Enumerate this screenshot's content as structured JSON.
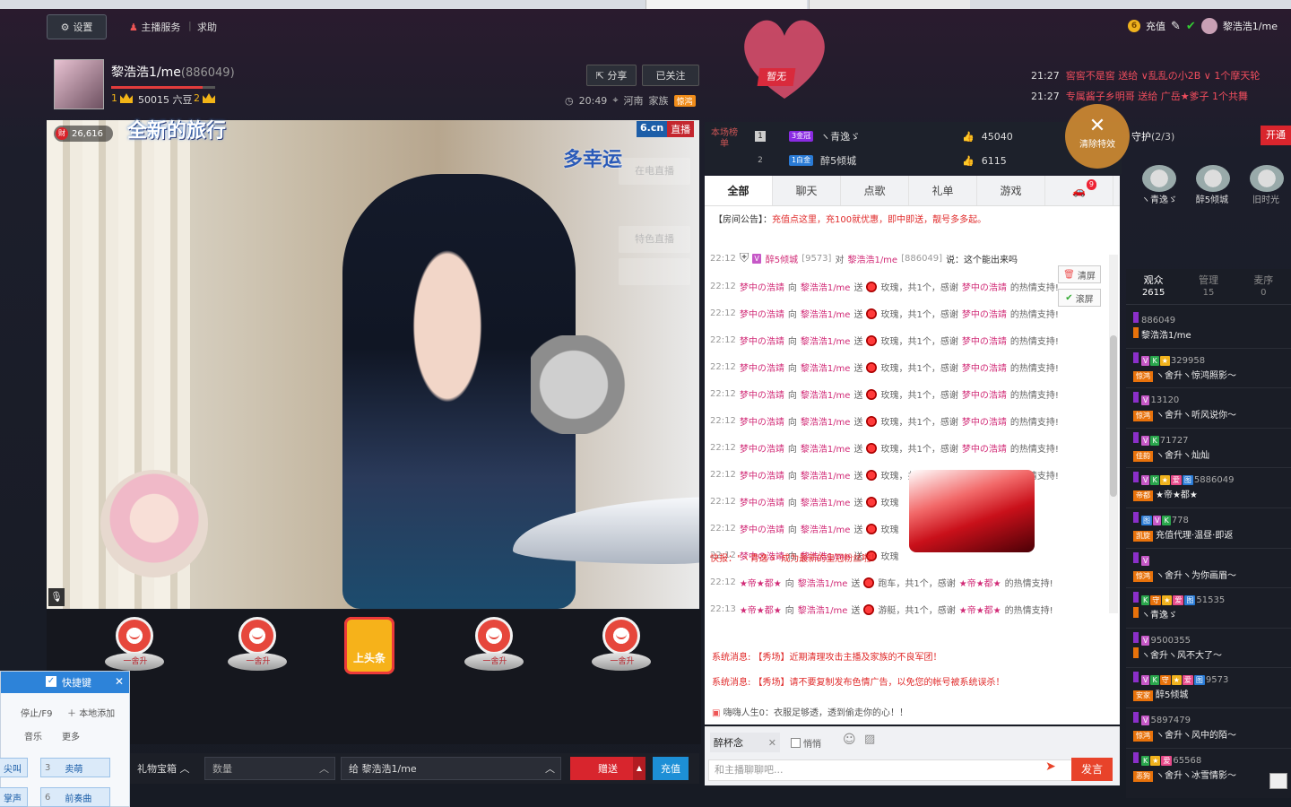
{
  "browser": {
    "tab1": "",
    "tab2": ""
  },
  "topbar": {
    "settings_label": "设置",
    "anchor_service": "主播服务",
    "help": "求助",
    "recharge": "充值",
    "username": "黎浩浩1/me"
  },
  "anchor": {
    "name": "黎浩浩1/me",
    "id": "(886049)",
    "level1": "1",
    "beans": "50015 六豆",
    "level2": "2",
    "share": "分享",
    "followed": "已关注",
    "time": "20:49",
    "location": "河南",
    "family_label": "家族",
    "family_tag": "惊鸿"
  },
  "status_tag": "暂无",
  "notifications": [
    {
      "time": "21:27",
      "text": "窖窖不是窖 送给 ∨乱乱の小2B ∨ 1个摩天轮"
    },
    {
      "time": "21:27",
      "text": "专属酱子乡明哥 送给 广岳★爹子 1个共舞"
    }
  ],
  "video": {
    "fire_count": "26,616",
    "title": "全新的旅行",
    "title2": "多幸运",
    "logo": "6.cn",
    "live": "直播",
    "side_buttons": [
      "在电直播",
      "特色直播",
      ""
    ],
    "mic_icon": "mic"
  },
  "gifts": [
    {
      "label": "一舍升"
    },
    {
      "label": "一舍升"
    },
    {
      "label": "上头条"
    },
    {
      "label": "一舍升"
    },
    {
      "label": "一舍升"
    }
  ],
  "bottombar": {
    "gift_box": "礼物宝箱",
    "quantity_placeholder": "数量",
    "to_target": "给 黎浩浩1/me",
    "send": "赠送",
    "recharge": "充值"
  },
  "quick": {
    "title": "快捷键",
    "stop": "停止/F9",
    "add_local": "本地添加",
    "tab_music": "音乐",
    "tab_more": "更多",
    "btn1_key": "",
    "btn1": "尖叫",
    "btn2_key": "3",
    "btn2": "卖萌",
    "btn3_key": "",
    "btn3": "掌声",
    "btn4_key": "6",
    "btn4": "前奏曲"
  },
  "rank": {
    "label": "本场榜单",
    "rows": [
      {
        "num": "1",
        "lv": "3金冠",
        "name": "ヽ青逸ゞ",
        "value": "45040"
      },
      {
        "num": "2",
        "lv": "1白金",
        "name": "醉5倾城",
        "value": "6115"
      }
    ]
  },
  "chat": {
    "tabs": [
      "全部",
      "聊天",
      "点歌",
      "礼单",
      "游戏",
      ""
    ],
    "car_count": "9",
    "notice_prefix": "【房间公告】：",
    "notice": "充值点这里，充100就优惠，即中即送，靓号多多起。",
    "first": {
      "time": "22:12",
      "user": "醉5倾城",
      "uid": "[9573]",
      "to": "黎浩浩1/me",
      "toid": "[886049]",
      "msg": "说：这个能出来吗"
    },
    "gift_lines": [
      {
        "time": "22:12",
        "from": "梦中の浩靖",
        "to": "黎浩浩1/me",
        "gift": "玫瑰，共1个，感谢",
        "thanks": "梦中の浩靖",
        "end": "的热情支持!"
      },
      {
        "time": "22:12",
        "from": "梦中の浩靖",
        "to": "黎浩浩1/me",
        "gift": "玫瑰，共1个，感谢",
        "thanks": "梦中の浩靖",
        "end": "的热情支持!"
      },
      {
        "time": "22:12",
        "from": "梦中の浩靖",
        "to": "黎浩浩1/me",
        "gift": "玫瑰，共1个，感谢",
        "thanks": "梦中の浩靖",
        "end": "的热情支持!"
      },
      {
        "time": "22:12",
        "from": "梦中の浩靖",
        "to": "黎浩浩1/me",
        "gift": "玫瑰，共1个，感谢",
        "thanks": "梦中の浩靖",
        "end": "的热情支持!"
      },
      {
        "time": "22:12",
        "from": "梦中の浩靖",
        "to": "黎浩浩1/me",
        "gift": "玫瑰，共1个，感谢",
        "thanks": "梦中の浩靖",
        "end": "的热情支持!"
      },
      {
        "time": "22:12",
        "from": "梦中の浩靖",
        "to": "黎浩浩1/me",
        "gift": "玫瑰，共1个，感谢",
        "thanks": "梦中の浩靖",
        "end": "的热情支持!"
      },
      {
        "time": "22:12",
        "from": "梦中の浩靖",
        "to": "黎浩浩1/me",
        "gift": "玫瑰，共1个，感谢",
        "thanks": "梦中の浩靖",
        "end": "的热情支持!"
      },
      {
        "time": "22:12",
        "from": "梦中の浩靖",
        "to": "黎浩浩1/me",
        "gift": "玫瑰，共1个，感谢",
        "thanks": "梦中の浩靖",
        "end": "的热情支持!"
      },
      {
        "time": "22:12",
        "from": "梦中の浩靖",
        "to": "黎浩浩1/me",
        "gift": "玫瑰",
        "thanks": "",
        "end": ""
      },
      {
        "time": "22:12",
        "from": "梦中の浩靖",
        "to": "黎浩浩1/me",
        "gift": "玫瑰",
        "thanks": "",
        "end": ""
      },
      {
        "time": "22:12",
        "from": "梦中の浩靖",
        "to": "黎浩浩1/me",
        "gift": "玫瑰",
        "thanks": "",
        "end": ""
      }
    ],
    "clear_screen": "清屏",
    "scroll_screen": "滚屏",
    "flash": "快报：\"ヽ青逸ゞ\"成为最新的皇冠粉丝啦！",
    "tail_lines": [
      {
        "time": "22:12",
        "from": "★帝★都★",
        "to": "黎浩浩1/me",
        "gift": "跑车，共1个，感谢",
        "thanks": "★帝★都★",
        "end": "的热情支持!"
      },
      {
        "time": "22:13",
        "from": "★帝★都★",
        "to": "黎浩浩1/me",
        "gift": "游艇，共1个，感谢",
        "thanks": "★帝★都★",
        "end": "的热情支持!"
      }
    ]
  },
  "system": {
    "line1": "系统消息: 【秀场】近期清理攻击主播及家族的不良军团！",
    "line2": "系统消息: 【秀场】请不要复制发布色情广告，以免您的帐号被系统误杀！",
    "line3": "嗨嗨人生0：衣服足够透，透到偷走你的心！！"
  },
  "input": {
    "target": "醉杯念",
    "secret": "悄悄",
    "placeholder": "和主播聊聊吧...",
    "send": "发言"
  },
  "guard": {
    "title": "守护",
    "count": "(2/3)",
    "open": "开通",
    "clear_fx": "清除特效",
    "members": [
      "ヽ青逸ゞ",
      "醉5倾城",
      "旧时光"
    ]
  },
  "viewers": {
    "tabs": [
      {
        "label": "观众",
        "count": "2615"
      },
      {
        "label": "管理",
        "count": "15"
      },
      {
        "label": "麦序",
        "count": "0"
      }
    ],
    "list": [
      {
        "id": "886049",
        "name": "黎浩浩1/me",
        "badges": "",
        "tag": ""
      },
      {
        "id": "329958",
        "name": "ヽ舍升ヽ惊鸿照影～",
        "badges": "V K ★",
        "tag": "惊鸿"
      },
      {
        "id": "13120",
        "name": "ヽ舍升ヽ听风说你～",
        "badges": "V",
        "tag": "惊鸿"
      },
      {
        "id": "71727",
        "name": "ヽ舍升ヽ灿灿",
        "badges": "V K",
        "tag": "佳韵"
      },
      {
        "id": "5886049",
        "name": "★帝★都★",
        "badges": "V K ★ 爱 图",
        "tag": "帝都"
      },
      {
        "id": "778",
        "name": "充值代理·温昼·即返",
        "badges": "图 V K",
        "tag": "凯旋"
      },
      {
        "id": "",
        "name": "ヽ舍升ヽ为你画眉～",
        "badges": "V",
        "tag": "惊鸿"
      },
      {
        "id": "51535",
        "name": "ヽ青逸ゞ",
        "badges": "K 守 ★ 爱 图",
        "tag": ""
      },
      {
        "id": "9500355",
        "name": "ヽ舍升ヽ风不大了～",
        "badges": "V",
        "tag": ""
      },
      {
        "id": "9573",
        "name": "醉5倾城",
        "badges": "V K 守 ★ 爱 图",
        "tag": "安家"
      },
      {
        "id": "5897479",
        "name": "ヽ舍升ヽ风中的陌～",
        "badges": "V",
        "tag": "惊鸿"
      },
      {
        "id": "65568",
        "name": "ヽ舍升ヽ冰雪情影～",
        "badges": "K ★ 爱",
        "tag": "恶狗"
      }
    ]
  },
  "colors": {
    "accent_red": "#d9252d",
    "link_pink": "#d12a76",
    "blue": "#1d8fd6"
  }
}
